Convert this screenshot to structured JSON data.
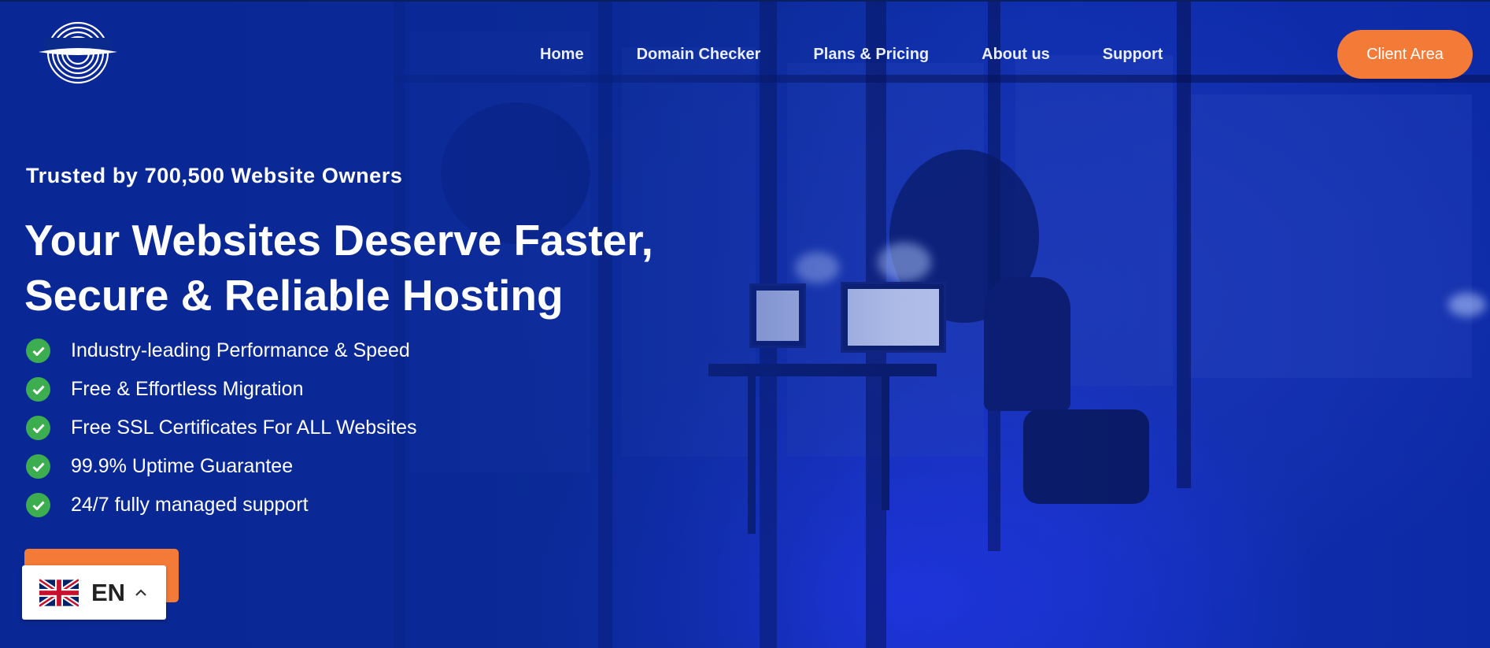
{
  "nav": {
    "items": [
      "Home",
      "Domain Checker",
      "Plans & Pricing",
      "About us",
      "Support"
    ],
    "client_area_label": "Client Area"
  },
  "hero": {
    "trusted": "Trusted by 700,500 Website Owners",
    "headline_line1": "Your Websites Deserve Faster,",
    "headline_line2": "Secure & Reliable Hosting",
    "features": [
      "Industry-leading Performance & Speed",
      "Free & Effortless Migration",
      "Free SSL Certificates For ALL Websites",
      "99.9% Uptime Guarantee",
      "24/7 fully managed support"
    ]
  },
  "language": {
    "code": "EN",
    "flag_icon": "uk-flag-icon"
  },
  "colors": {
    "accent": "#f47b37",
    "check": "#3cae4f",
    "overlay": "#0b2aa0"
  }
}
